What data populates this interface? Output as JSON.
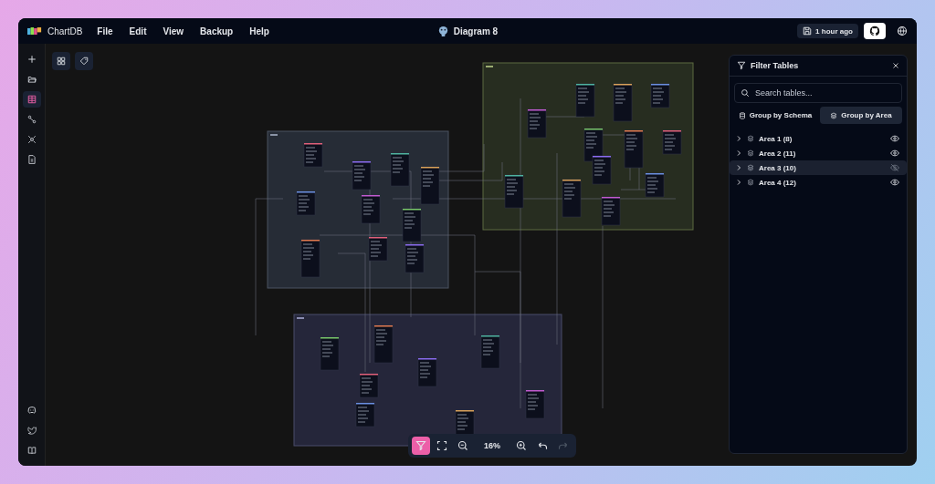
{
  "app": {
    "name": "ChartDB"
  },
  "menu": [
    "File",
    "Edit",
    "View",
    "Backup",
    "Help"
  ],
  "diagram": {
    "title": "Diagram 8"
  },
  "save_status": "1 hour ago",
  "sidebar": [
    {
      "kind": "add",
      "selected": false
    },
    {
      "kind": "open",
      "selected": false
    },
    {
      "kind": "tables",
      "selected": true
    },
    {
      "kind": "relationships",
      "selected": false
    },
    {
      "kind": "dependencies",
      "selected": false
    },
    {
      "kind": "export",
      "selected": false
    }
  ],
  "sidebar_bottom": [
    {
      "kind": "discord"
    },
    {
      "kind": "twitter"
    },
    {
      "kind": "docs"
    }
  ],
  "filter_panel": {
    "title": "Filter Tables",
    "search": {
      "placeholder": "Search tables..."
    },
    "group_options": [
      {
        "label": "Group by Schema",
        "selected": false
      },
      {
        "label": "Group by Area",
        "selected": true
      }
    ],
    "areas": [
      {
        "label": "Area 1 (8)",
        "visible": true,
        "selected": false
      },
      {
        "label": "Area 2 (11)",
        "visible": true,
        "selected": false
      },
      {
        "label": "Area 3 (10)",
        "visible": false,
        "selected": true
      },
      {
        "label": "Area 4 (12)",
        "visible": true,
        "selected": false
      }
    ]
  },
  "toolbar": {
    "filter_active": true,
    "zoom": "16%",
    "redo_disabled": true
  }
}
